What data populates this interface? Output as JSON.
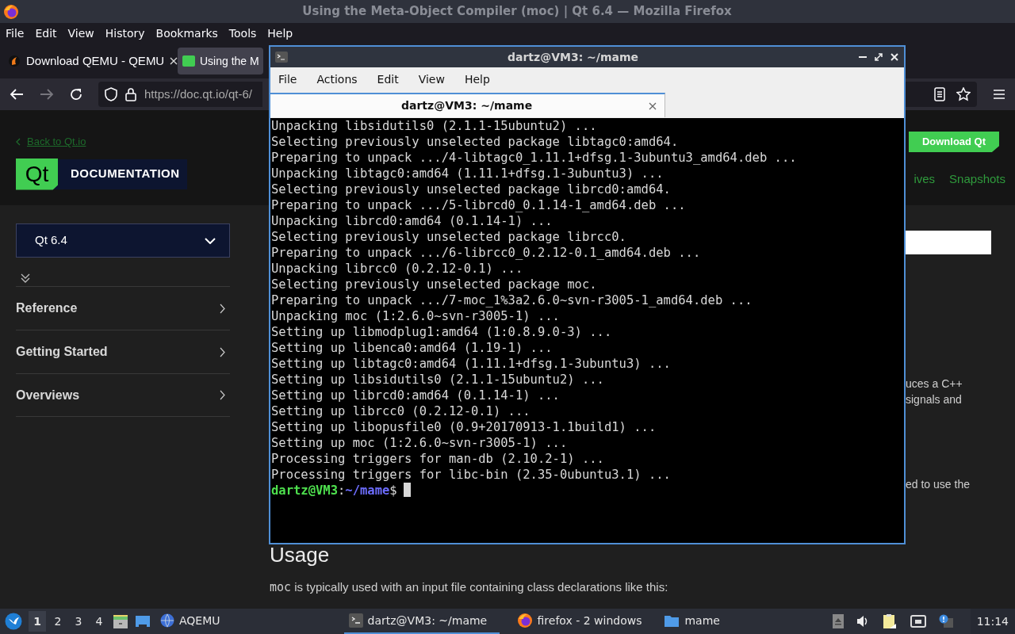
{
  "window": {
    "title": "Using the Meta-Object Compiler (moc) | Qt 6.4 — Mozilla Firefox"
  },
  "menu": [
    "File",
    "Edit",
    "View",
    "History",
    "Bookmarks",
    "Tools",
    "Help"
  ],
  "tabs": [
    {
      "label": "Download QEMU - QEMU",
      "selected": false,
      "kind": "qemu"
    },
    {
      "label": "Using the M",
      "selected": true,
      "kind": "qt"
    }
  ],
  "address_bar": {
    "url": "https://doc.qt.io/qt-6/"
  },
  "page": {
    "back_link": "Back to Qt.io",
    "logo": "Qt",
    "logo_caption": "DOCUMENTATION",
    "download_button": "Download Qt",
    "nav_links": [
      "ives",
      "Snapshots"
    ],
    "version_select": "Qt 6.4",
    "sidebar_items": [
      "Reference",
      "Getting Started",
      "Overviews"
    ],
    "fragments": [
      "uces a C++",
      "signals and",
      "ed to use the"
    ],
    "heading": "Usage",
    "paragraph_code": "moc",
    "paragraph": " is typically used with an input file containing class declarations like this:"
  },
  "terminal": {
    "title": "dartz@VM3: ~/mame",
    "menu": [
      "File",
      "Actions",
      "Edit",
      "View",
      "Help"
    ],
    "tab": "dartz@VM3: ~/mame",
    "lines": [
      "Unpacking libsidutils0 (2.1.1-15ubuntu2) ...",
      "Selecting previously unselected package libtagc0:amd64.",
      "Preparing to unpack .../4-libtagc0_1.11.1+dfsg.1-3ubuntu3_amd64.deb ...",
      "Unpacking libtagc0:amd64 (1.11.1+dfsg.1-3ubuntu3) ...",
      "Selecting previously unselected package librcd0:amd64.",
      "Preparing to unpack .../5-librcd0_0.1.14-1_amd64.deb ...",
      "Unpacking librcd0:amd64 (0.1.14-1) ...",
      "Selecting previously unselected package librcc0.",
      "Preparing to unpack .../6-librcc0_0.2.12-0.1_amd64.deb ...",
      "Unpacking librcc0 (0.2.12-0.1) ...",
      "Selecting previously unselected package moc.",
      "Preparing to unpack .../7-moc_1%3a2.6.0~svn-r3005-1_amd64.deb ...",
      "Unpacking moc (1:2.6.0~svn-r3005-1) ...",
      "Setting up libmodplug1:amd64 (1:0.8.9.0-3) ...",
      "Setting up libenca0:amd64 (1.19-1) ...",
      "Setting up libtagc0:amd64 (1.11.1+dfsg.1-3ubuntu3) ...",
      "Setting up libsidutils0 (2.1.1-15ubuntu2) ...",
      "Setting up librcd0:amd64 (0.1.14-1) ...",
      "Setting up librcc0 (0.2.12-0.1) ...",
      "Setting up libopusfile0 (0.9+20170913-1.1build1) ...",
      "Setting up moc (1:2.6.0~svn-r3005-1) ...",
      "Processing triggers for man-db (2.10.2-1) ...",
      "Processing triggers for libc-bin (2.35-0ubuntu3.1) ..."
    ],
    "prompt": {
      "user": "dartz@VM3",
      "separator": ":",
      "path": "~/mame",
      "symbol": "$"
    }
  },
  "taskbar": {
    "workspaces": [
      {
        "label": "1",
        "selected": true
      },
      {
        "label": "2",
        "selected": false
      },
      {
        "label": "3",
        "selected": false
      },
      {
        "label": "4",
        "selected": false
      }
    ],
    "launcher": "AQEMU",
    "tasks": [
      {
        "label": "dartz@VM3: ~/mame",
        "kind": "terminal",
        "selected": true
      },
      {
        "label": "firefox - 2 windows",
        "kind": "firefox",
        "selected": false
      },
      {
        "label": "mame",
        "kind": "folder",
        "selected": false
      }
    ],
    "clock": "11:14"
  }
}
